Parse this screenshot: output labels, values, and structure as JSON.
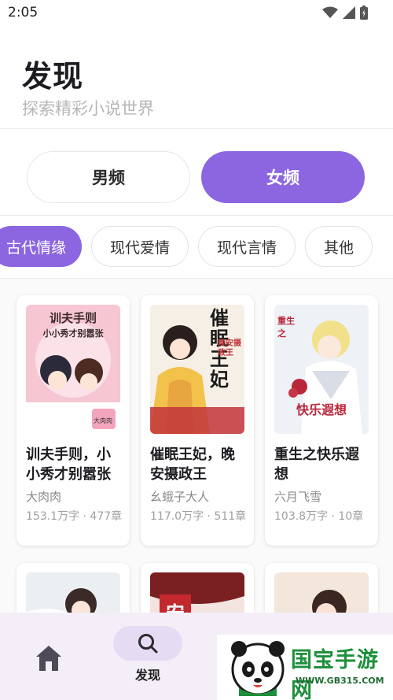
{
  "status_bar": {
    "time": "2:05",
    "icons": [
      "wifi-icon",
      "signal-icon",
      "battery-icon"
    ]
  },
  "header": {
    "title": "发现",
    "subtitle": "探索精彩小说世界"
  },
  "gender_tabs": [
    {
      "label": "男频",
      "selected": false
    },
    {
      "label": "女频",
      "selected": true
    }
  ],
  "categories": [
    {
      "label": "古代情缘",
      "selected": true
    },
    {
      "label": "现代爱情",
      "selected": false
    },
    {
      "label": "现代言情",
      "selected": false
    },
    {
      "label": "其他",
      "selected": false
    }
  ],
  "books": [
    {
      "title": "训夫手则，小小秀才别嚣张",
      "author": "大肉肉",
      "meta": "153.1万字 · 477章",
      "cover_text": "训夫手则",
      "cover_sub": "小小秀才别嚣张",
      "cover_tag": "大肉肉"
    },
    {
      "title": "催眠王妃，晚安摄政王",
      "author": "幺蛾子大人",
      "meta": "117.0万字 · 511章",
      "cover_text": "催眠王妃",
      "cover_sub": "晚安摄政王"
    },
    {
      "title": "重生之快乐遐想",
      "author": "六月飞雪",
      "meta": "103.8万字 · 10章",
      "cover_text": "重生之",
      "cover_sub": "快乐遐想"
    },
    {
      "title": "",
      "author": "",
      "meta": ""
    },
    {
      "title": "",
      "author": "",
      "meta": "",
      "cover_text": "安"
    },
    {
      "title": "",
      "author": "",
      "meta": ""
    }
  ],
  "bottom_nav": {
    "items": [
      {
        "icon": "home-icon",
        "label": ""
      },
      {
        "icon": "search-icon",
        "label": "发现",
        "selected": true
      }
    ]
  },
  "watermark": {
    "text": "国宝手游网",
    "url": "WWW.GB315.COM"
  },
  "colors": {
    "accent": "#8c66e0",
    "nav_bg": "#f3eef8",
    "pill": "#e5dcf4"
  }
}
